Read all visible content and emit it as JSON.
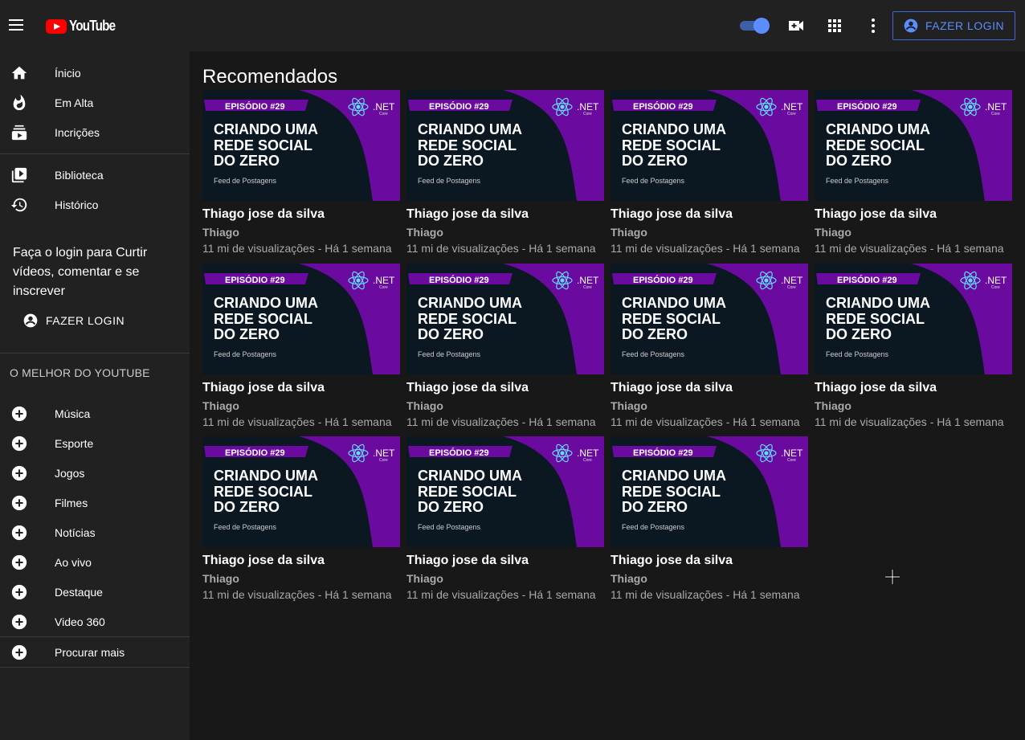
{
  "header": {
    "logo": "YouTube",
    "login_label": "FAZER LOGIN",
    "icons": [
      "menu-icon",
      "theme-toggle",
      "video-camera-add-icon",
      "apps-grid-icon",
      "more-vert-icon",
      "account-circle-icon"
    ]
  },
  "sidebar": {
    "main": [
      {
        "label": "Ínicio",
        "icon": "home-icon"
      },
      {
        "label": "Em Alta",
        "icon": "fire-icon"
      },
      {
        "label": "Incrições",
        "icon": "subscriptions-icon"
      }
    ],
    "library": [
      {
        "label": "Biblioteca",
        "icon": "library-icon"
      },
      {
        "label": "Histórico",
        "icon": "history-icon"
      }
    ],
    "promo": "Faça o login para Curtir vídeos, comentar e se inscrever",
    "login_label": "FAZER LOGIN",
    "section_title": "O MELHOR DO YOUTUBE",
    "best": [
      {
        "label": "Música"
      },
      {
        "label": "Esporte"
      },
      {
        "label": "Jogos"
      },
      {
        "label": "Filmes"
      },
      {
        "label": "Notícias"
      },
      {
        "label": "Ao vivo"
      },
      {
        "label": "Destaque"
      },
      {
        "label": "Video 360"
      }
    ],
    "more": {
      "label": "Procurar mais"
    }
  },
  "main": {
    "title": "Recomendados",
    "thumbnail": {
      "badge": "EPISÓDIO #29",
      "line1": "CRIANDO UMA",
      "line2": "REDE SOCIAL",
      "line3": "DO ZERO",
      "subtitle": "Feed de Postagens",
      "brand": ".NET",
      "brand_sub": "Core",
      "colors": {
        "bg": "#0b1822",
        "purple": "#6a0a9e",
        "react": "#61dafb"
      }
    },
    "videos": [
      {
        "title": "Thiago jose da silva",
        "channel": "Thiago",
        "meta": "11 mi de visualizações - Há 1 semana"
      },
      {
        "title": "Thiago jose da silva",
        "channel": "Thiago",
        "meta": "11 mi de visualizações - Há 1 semana"
      },
      {
        "title": "Thiago jose da silva",
        "channel": "Thiago",
        "meta": "11 mi de visualizações - Há 1 semana"
      },
      {
        "title": "Thiago jose da silva",
        "channel": "Thiago",
        "meta": "11 mi de visualizações - Há 1 semana"
      },
      {
        "title": "Thiago jose da silva",
        "channel": "Thiago",
        "meta": "11 mi de visualizações - Há 1 semana"
      },
      {
        "title": "Thiago jose da silva",
        "channel": "Thiago",
        "meta": "11 mi de visualizações - Há 1 semana"
      },
      {
        "title": "Thiago jose da silva",
        "channel": "Thiago",
        "meta": "11 mi de visualizações - Há 1 semana"
      },
      {
        "title": "Thiago jose da silva",
        "channel": "Thiago",
        "meta": "11 mi de visualizações - Há 1 semana"
      },
      {
        "title": "Thiago jose da silva",
        "channel": "Thiago",
        "meta": "11 mi de visualizações - Há 1 semana"
      },
      {
        "title": "Thiago jose da silva",
        "channel": "Thiago",
        "meta": "11 mi de visualizações - Há 1 semana"
      },
      {
        "title": "Thiago jose da silva",
        "channel": "Thiago",
        "meta": "11 mi de visualizações - Há 1 semana"
      }
    ]
  }
}
